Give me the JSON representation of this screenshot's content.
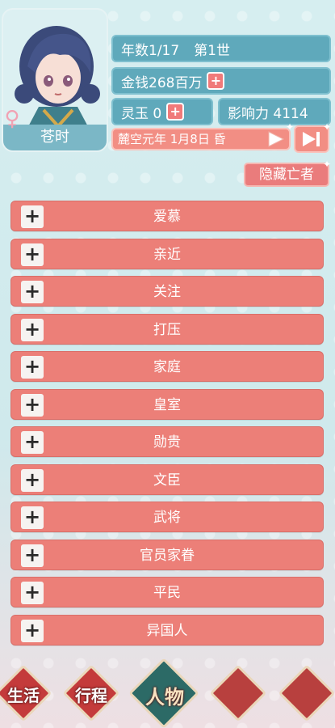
{
  "character": {
    "name": "苍时",
    "gender_icon": "female-symbol-icon"
  },
  "stats": {
    "year_label": "年数1/17",
    "generation_label": "第1世",
    "money_label": "金钱268百万",
    "jade_label": "灵玉 0",
    "influence_label": "影响力 4114",
    "date_label": "麓空元年 1月8日 昏"
  },
  "buttons": {
    "hide_dead": "隐藏亡者",
    "plus": "+"
  },
  "categories": [
    {
      "label": "爱慕"
    },
    {
      "label": "亲近"
    },
    {
      "label": "关注"
    },
    {
      "label": "打压"
    },
    {
      "label": "家庭"
    },
    {
      "label": "皇室"
    },
    {
      "label": "勋贵"
    },
    {
      "label": "文臣"
    },
    {
      "label": "武将"
    },
    {
      "label": "官员家眷"
    },
    {
      "label": "平民"
    },
    {
      "label": "异国人"
    }
  ],
  "nav": {
    "life": "生活",
    "trip": "行程",
    "people": "人物"
  },
  "colors": {
    "stat_bar": "#5fa9bb",
    "accent_red": "#ec7f78",
    "date_bar": "#f28e84",
    "nav_selected": "#2c6a66"
  }
}
